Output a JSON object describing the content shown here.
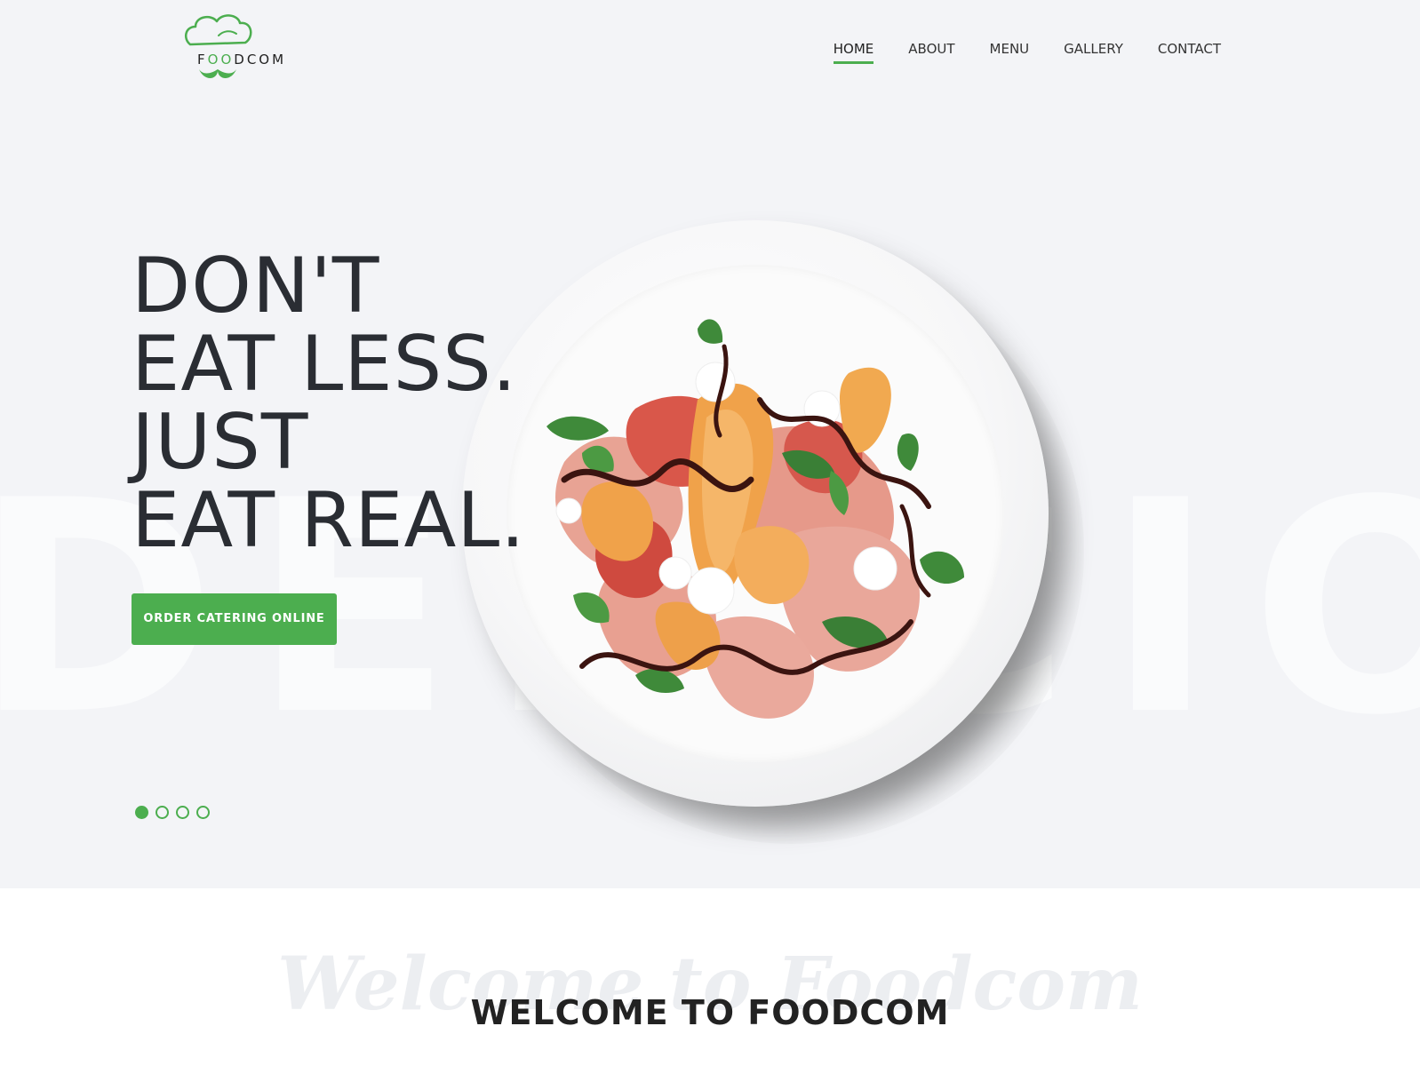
{
  "brand": {
    "name_prefix": "F",
    "name_accent": "OO",
    "name_suffix": "DCOM",
    "accent_color": "#4cae4f"
  },
  "nav": {
    "items": [
      {
        "label": "HOME",
        "active": true
      },
      {
        "label": "ABOUT"
      },
      {
        "label": "MENU"
      },
      {
        "label": "GALLERY"
      },
      {
        "label": "CONTACT"
      }
    ]
  },
  "hero": {
    "background_word": "DELICIOUS",
    "headline_lines": [
      "DON'T",
      "EAT LESS.",
      "JUST",
      "EAT REAL."
    ],
    "cta_label": "ORDER CATERING ONLINE",
    "slider": {
      "total": 4,
      "active_index": 1
    },
    "image_subject": "plate of melon, prosciutto, mozzarella, mint and balsamic"
  },
  "welcome": {
    "script_text": "Welcome to Foodcom",
    "title": "WELCOME TO FOODCOM"
  }
}
